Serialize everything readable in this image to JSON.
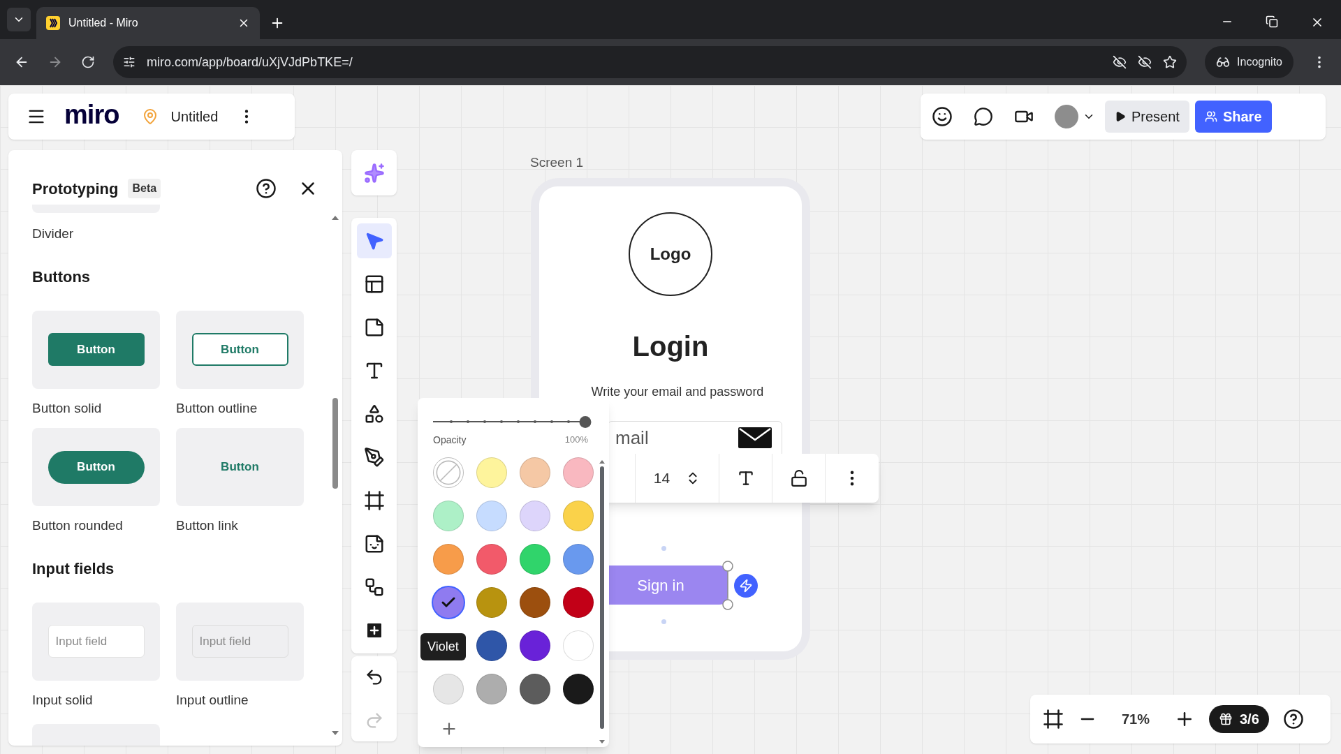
{
  "browser": {
    "tab_title": "Untitled - Miro",
    "url": "miro.com/app/board/uXjVJdPbTKE=/",
    "incognito_label": "Incognito"
  },
  "board": {
    "logo": "miro",
    "title": "Untitled"
  },
  "top_toolbar": {
    "present": "Present",
    "share": "Share"
  },
  "panel": {
    "title": "Prototyping",
    "badge": "Beta",
    "first_item_label": "Divider",
    "sections": [
      {
        "heading": "Buttons",
        "items": [
          {
            "kind": "button_solid",
            "preview": "Button",
            "label": "Button solid"
          },
          {
            "kind": "button_outline",
            "preview": "Button",
            "label": "Button outline"
          },
          {
            "kind": "button_rounded",
            "preview": "Button",
            "label": "Button rounded"
          },
          {
            "kind": "button_link",
            "preview": "Button",
            "label": "Button link"
          }
        ]
      },
      {
        "heading": "Input fields",
        "items": [
          {
            "kind": "input_solid",
            "preview": "Input field",
            "label": "Input solid"
          },
          {
            "kind": "input_outline",
            "preview": "Input field",
            "label": "Input outline"
          }
        ]
      }
    ]
  },
  "tools": [
    {
      "kind": "select",
      "selected": true
    },
    {
      "kind": "templates",
      "selected": false
    },
    {
      "kind": "sticky",
      "selected": false
    },
    {
      "kind": "text",
      "selected": false
    },
    {
      "kind": "shapes",
      "selected": false
    },
    {
      "kind": "pen",
      "selected": false
    },
    {
      "kind": "frame",
      "selected": false
    },
    {
      "kind": "sticker",
      "selected": false
    },
    {
      "kind": "diagram",
      "selected": false
    },
    {
      "kind": "more",
      "selected": false
    }
  ],
  "frame": {
    "label": "Screen 1",
    "logo": "Logo",
    "heading": "Login",
    "subtitle": "Write your email and password",
    "email_placeholder": "mail",
    "sign_in": "Sign in"
  },
  "text_toolbar": {
    "font_size": "14"
  },
  "color_picker": {
    "opacity_label": "Opacity",
    "opacity_value": "100%",
    "level": 1,
    "tooltip": "Violet",
    "rows": [
      {
        "swatches": [
          {
            "kind": "none",
            "selected": false
          },
          {
            "kind": "color",
            "color": "#fef49c",
            "selected": false
          },
          {
            "kind": "color",
            "color": "#f5c8a5",
            "selected": false
          },
          {
            "kind": "color",
            "color": "#f9b8c0",
            "selected": false
          }
        ]
      },
      {
        "swatches": [
          {
            "kind": "color",
            "color": "#adf0c7",
            "selected": false
          },
          {
            "kind": "color",
            "color": "#c6dcff",
            "selected": false
          },
          {
            "kind": "color",
            "color": "#ddd5fb",
            "selected": false
          },
          {
            "kind": "color",
            "color": "#fad24a",
            "selected": false
          }
        ]
      },
      {
        "swatches": [
          {
            "kind": "color",
            "color": "#f79c4a",
            "selected": false
          },
          {
            "kind": "color",
            "color": "#f25a6a",
            "selected": false
          },
          {
            "kind": "color",
            "color": "#30d46b",
            "selected": false
          },
          {
            "kind": "color",
            "color": "#6999ee",
            "selected": false
          }
        ]
      },
      {
        "swatches": [
          {
            "kind": "color",
            "color": "#8f7bf0",
            "selected": true
          },
          {
            "kind": "color",
            "color": "#b8930f",
            "selected": false
          },
          {
            "kind": "color",
            "color": "#9c4f0e",
            "selected": false
          },
          {
            "kind": "color",
            "color": "#c20017",
            "selected": false
          }
        ]
      },
      {
        "swatches": [
          {
            "kind": "color",
            "color": "#2f56a8",
            "selected": false
          },
          {
            "kind": "color",
            "color": "#6922d8",
            "selected": false
          },
          {
            "kind": "color",
            "color": "#ffffff",
            "selected": false
          }
        ]
      },
      {
        "swatches": [
          {
            "kind": "color",
            "color": "#e6e6e6",
            "selected": false
          },
          {
            "kind": "color",
            "color": "#adadad",
            "selected": false
          },
          {
            "kind": "color",
            "color": "#5c5c5c",
            "selected": false
          },
          {
            "kind": "color",
            "color": "#1a1a1a",
            "selected": false
          }
        ]
      }
    ]
  },
  "zoom": {
    "value": "71%",
    "count": "3/6"
  }
}
